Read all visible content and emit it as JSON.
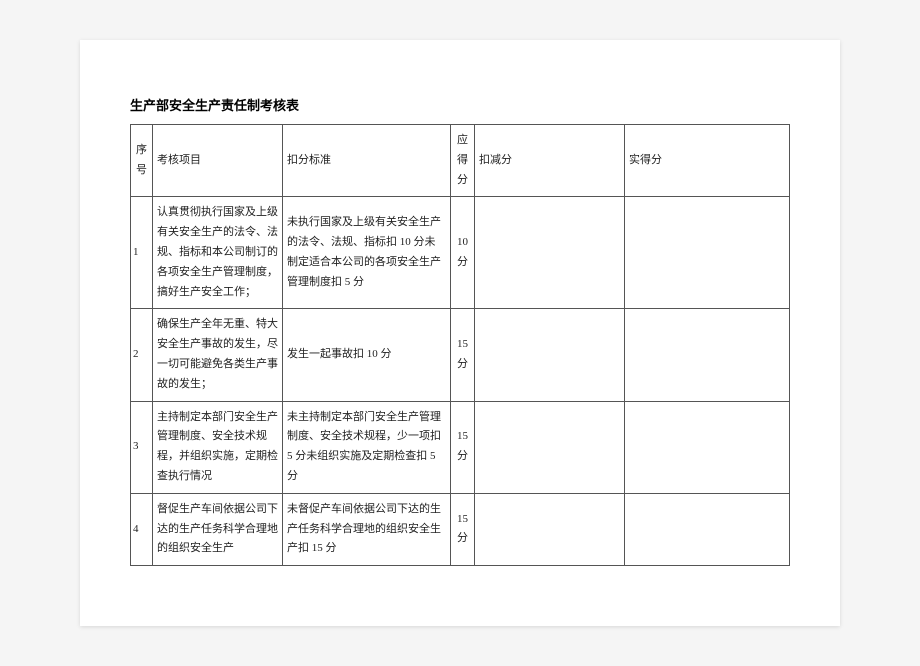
{
  "title": "生产部安全生产责任制考核表",
  "headers": {
    "num": "序号",
    "item": "考核项目",
    "criteria": "扣分标准",
    "score": "应得分",
    "deduct": "扣减分",
    "actual": "实得分"
  },
  "rows": [
    {
      "num": "1",
      "item": "认真贯彻执行国家及上级有关安全生产的法令、法规、指标和本公司制订的各项安全生产管理制度，搞好生产安全工作；",
      "criteria": "未执行国家及上级有关安全生产的法令、法规、指标扣 10 分未制定适合本公司的各项安全生产管理制度扣 5 分",
      "score": "10分",
      "deduct": "",
      "actual": ""
    },
    {
      "num": "2",
      "item": "确保生产全年无重、特大安全生产事故的发生，尽一切可能避免各类生产事故的发生；",
      "criteria": "发生一起事故扣 10 分",
      "score": "15分",
      "deduct": "",
      "actual": ""
    },
    {
      "num": "3",
      "item": "主持制定本部门安全生产管理制度、安全技术规程，并组织实施，定期检查执行情况",
      "criteria": "未主持制定本部门安全生产管理制度、安全技术规程，少一项扣 5 分未组织实施及定期检查扣 5 分",
      "score": "15分",
      "deduct": "",
      "actual": ""
    },
    {
      "num": "4",
      "item": "督促生产车间依据公司下达的生产任务科学合理地的组织安全生产",
      "criteria": "未督促产车间依据公司下达的生产任务科学合理地的组织安全生产扣 15 分",
      "score": "15分",
      "deduct": "",
      "actual": ""
    }
  ]
}
